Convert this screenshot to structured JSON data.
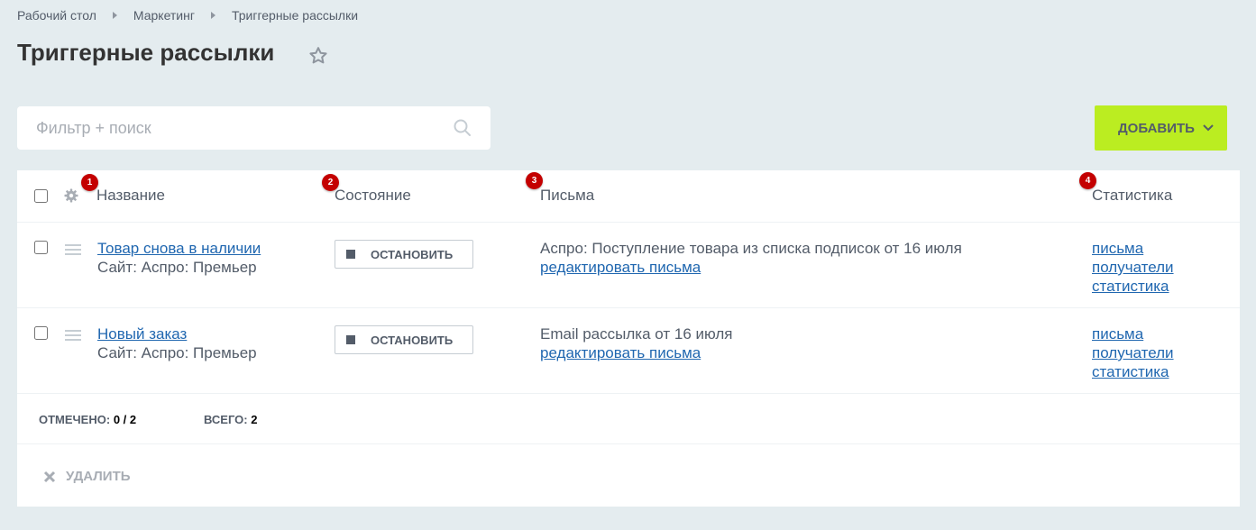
{
  "breadcrumb": {
    "items": [
      "Рабочий стол",
      "Маркетинг",
      "Триггерные рассылки"
    ]
  },
  "page": {
    "title": "Триггерные рассылки"
  },
  "filter": {
    "placeholder": "Фильтр + поиск",
    "value": ""
  },
  "toolbar": {
    "add_label": "ДОБАВИТЬ"
  },
  "grid": {
    "columns": [
      {
        "label": "Название",
        "badge": "1"
      },
      {
        "label": "Состояние",
        "badge": "2"
      },
      {
        "label": "Письма",
        "badge": "3"
      },
      {
        "label": "Статистика",
        "badge": "4"
      }
    ],
    "rows": [
      {
        "name": "Товар снова в наличии",
        "site": "Сайт: Аспро: Премьер",
        "state_button": "ОСТАНОВИТЬ",
        "letters": "Аспро: Поступление товара из списка подписок от 16 июля",
        "edit_letters": "редактировать письма",
        "stats": [
          "письма",
          "получатели",
          "статистика"
        ]
      },
      {
        "name": "Новый заказ",
        "site": "Сайт: Аспро: Премьер",
        "state_button": "ОСТАНОВИТЬ",
        "letters": "Email рассылка от 16 июля",
        "edit_letters": "редактировать письма",
        "stats": [
          "письма",
          "получатели",
          "статистика"
        ]
      }
    ],
    "footer": {
      "selected_label": "ОТМЕЧЕНО:",
      "selected_value": "0 / 2",
      "total_label": "ВСЕГО:",
      "total_value": "2"
    },
    "actions": {
      "delete_label": "УДАЛИТЬ"
    }
  },
  "colors": {
    "background": "#e4ecef",
    "accent_button": "#bbed21",
    "link": "#2067b0",
    "badge": "#c40000"
  },
  "icons": {
    "favorite": "star-icon",
    "search": "search-icon",
    "dropdown": "chevron-down-icon",
    "settings": "gear-icon",
    "drag": "drag-handle-icon",
    "stop": "stop-icon",
    "delete": "close-icon"
  }
}
